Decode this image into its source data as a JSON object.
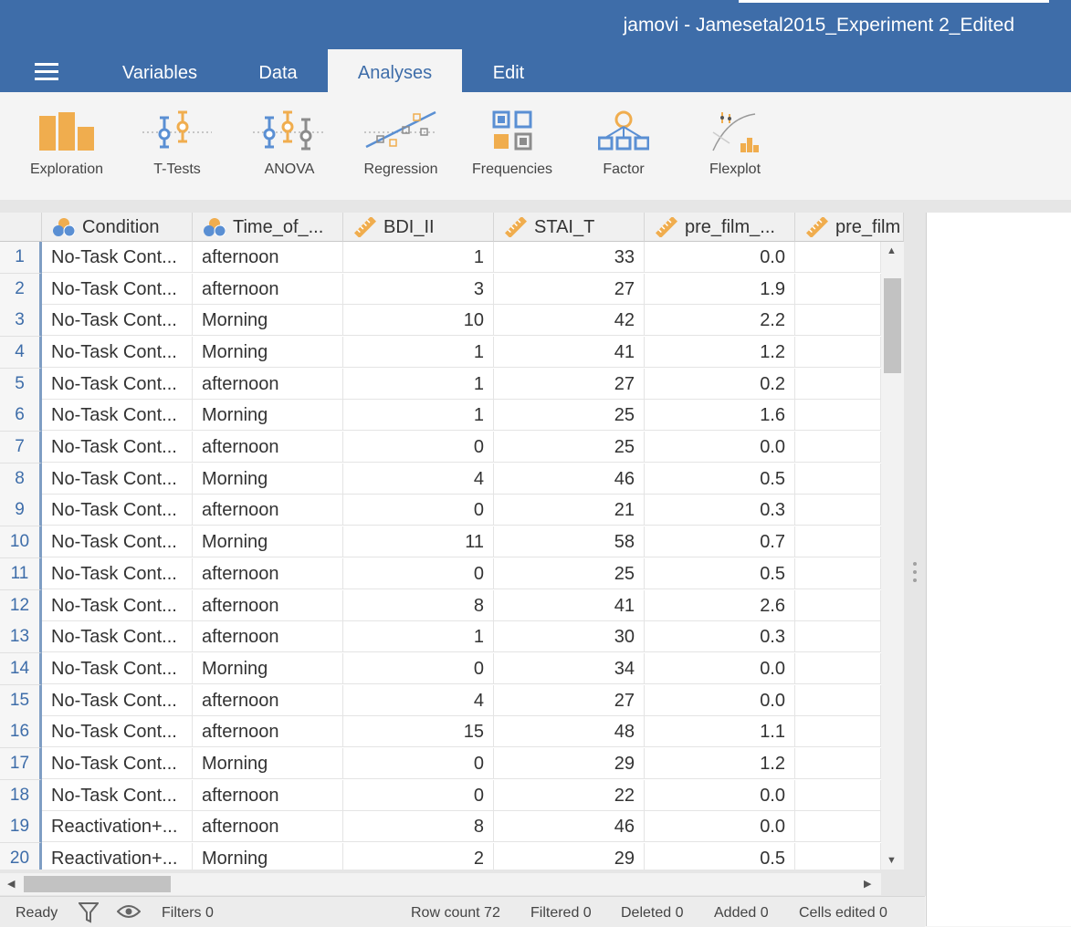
{
  "window": {
    "title": "jamovi - Jamesetal2015_Experiment 2_Edited"
  },
  "tabs": [
    {
      "label": "Variables"
    },
    {
      "label": "Data"
    },
    {
      "label": "Analyses",
      "active": true
    },
    {
      "label": "Edit"
    }
  ],
  "ribbon": [
    {
      "label": "Exploration",
      "icon": "exploration-bars-icon"
    },
    {
      "label": "T-Tests",
      "icon": "t-tests-icon"
    },
    {
      "label": "ANOVA",
      "icon": "anova-icon"
    },
    {
      "label": "Regression",
      "icon": "regression-icon"
    },
    {
      "label": "Frequencies",
      "icon": "frequencies-icon"
    },
    {
      "label": "Factor",
      "icon": "factor-icon"
    },
    {
      "label": "Flexplot",
      "icon": "flexplot-icon"
    }
  ],
  "columns": [
    {
      "label": "Condition",
      "type": "nominal"
    },
    {
      "label": "Time_of_...",
      "type": "nominal"
    },
    {
      "label": "BDI_II",
      "type": "continuous"
    },
    {
      "label": "STAI_T",
      "type": "continuous"
    },
    {
      "label": "pre_film_...",
      "type": "continuous"
    },
    {
      "label": "pre_film",
      "type": "continuous"
    }
  ],
  "rows": [
    {
      "n": "1",
      "cells": [
        "No-Task Cont...",
        "afternoon",
        "1",
        "33",
        "0.0"
      ]
    },
    {
      "n": "2",
      "cells": [
        "No-Task Cont...",
        "afternoon",
        "3",
        "27",
        "1.9"
      ]
    },
    {
      "n": "3",
      "cells": [
        "No-Task Cont...",
        "Morning",
        "10",
        "42",
        "2.2"
      ]
    },
    {
      "n": "4",
      "cells": [
        "No-Task Cont...",
        "Morning",
        "1",
        "41",
        "1.2"
      ]
    },
    {
      "n": "5",
      "cells": [
        "No-Task Cont...",
        "afternoon",
        "1",
        "27",
        "0.2"
      ]
    },
    {
      "n": "6",
      "cells": [
        "No-Task Cont...",
        "Morning",
        "1",
        "25",
        "1.6"
      ]
    },
    {
      "n": "7",
      "cells": [
        "No-Task Cont...",
        "afternoon",
        "0",
        "25",
        "0.0"
      ]
    },
    {
      "n": "8",
      "cells": [
        "No-Task Cont...",
        "Morning",
        "4",
        "46",
        "0.5"
      ]
    },
    {
      "n": "9",
      "cells": [
        "No-Task Cont...",
        "afternoon",
        "0",
        "21",
        "0.3"
      ]
    },
    {
      "n": "10",
      "cells": [
        "No-Task Cont...",
        "Morning",
        "11",
        "58",
        "0.7"
      ]
    },
    {
      "n": "11",
      "cells": [
        "No-Task Cont...",
        "afternoon",
        "0",
        "25",
        "0.5"
      ]
    },
    {
      "n": "12",
      "cells": [
        "No-Task Cont...",
        "afternoon",
        "8",
        "41",
        "2.6"
      ]
    },
    {
      "n": "13",
      "cells": [
        "No-Task Cont...",
        "afternoon",
        "1",
        "30",
        "0.3"
      ]
    },
    {
      "n": "14",
      "cells": [
        "No-Task Cont...",
        "Morning",
        "0",
        "34",
        "0.0"
      ]
    },
    {
      "n": "15",
      "cells": [
        "No-Task Cont...",
        "afternoon",
        "4",
        "27",
        "0.0"
      ]
    },
    {
      "n": "16",
      "cells": [
        "No-Task Cont...",
        "afternoon",
        "15",
        "48",
        "1.1"
      ]
    },
    {
      "n": "17",
      "cells": [
        "No-Task Cont...",
        "Morning",
        "0",
        "29",
        "1.2"
      ]
    },
    {
      "n": "18",
      "cells": [
        "No-Task Cont...",
        "afternoon",
        "0",
        "22",
        "0.0"
      ]
    },
    {
      "n": "19",
      "cells": [
        "Reactivation+...",
        "afternoon",
        "8",
        "46",
        "0.0"
      ]
    },
    {
      "n": "20",
      "cells": [
        "Reactivation+...",
        "Morning",
        "2",
        "29",
        "0.5"
      ]
    }
  ],
  "status": {
    "ready": "Ready",
    "filters": "Filters 0",
    "row_count": "Row count 72",
    "filtered": "Filtered 0",
    "deleted": "Deleted 0",
    "added": "Added 0",
    "cells_edited": "Cells edited 0"
  },
  "colors": {
    "header": "#3e6da9",
    "accent": "#f0ad4e",
    "blue_icon": "#5a8fd3"
  }
}
